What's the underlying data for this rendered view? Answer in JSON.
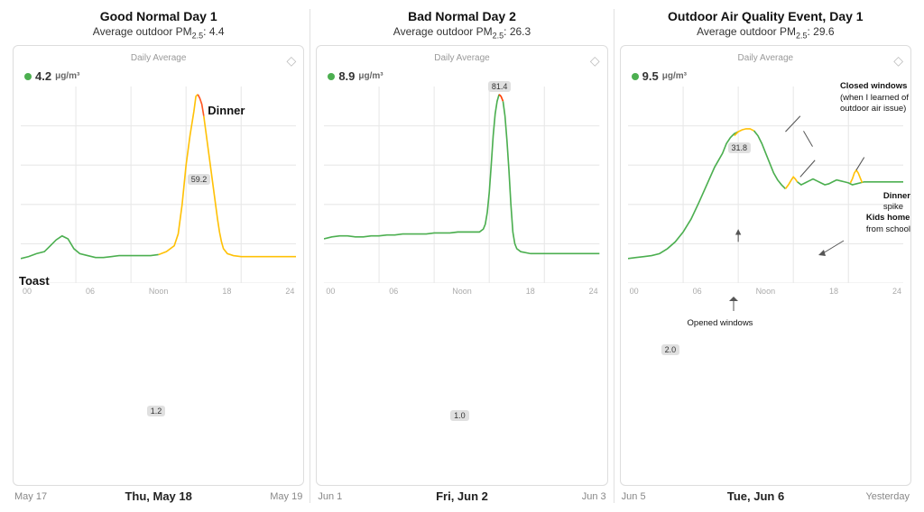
{
  "panels": [
    {
      "id": "panel1",
      "title": "Good Normal Day 1",
      "subtitle": "Average outdoor PM",
      "subtitle_sub": "2.5",
      "subtitle_value": ": 4.4",
      "daily_avg_label": "Daily Average",
      "avg_value": "4.2",
      "avg_unit": "μg/m³",
      "annotations": [
        {
          "label": "Dinner",
          "style": "bold",
          "x_pct": 73,
          "y_pct": 12
        },
        {
          "label": "Toast",
          "style": "bold",
          "x_pct": 5,
          "y_pct": 65
        }
      ],
      "badges": [
        {
          "value": "59.2",
          "x_pct": 68,
          "y_pct": 26
        },
        {
          "value": "1.2",
          "x_pct": 52,
          "y_pct": 85
        }
      ],
      "x_labels": [
        "00",
        "06",
        "Noon",
        "18",
        "24"
      ],
      "dates": {
        "left": "May 17",
        "main": "Thu, May 18",
        "right": "May 19"
      }
    },
    {
      "id": "panel2",
      "title": "Bad Normal Day 2",
      "subtitle": "Average outdoor PM",
      "subtitle_sub": "2.5",
      "subtitle_value": ": 26.3",
      "daily_avg_label": "Daily Average",
      "avg_value": "8.9",
      "avg_unit": "μg/m³",
      "annotations": [],
      "badges": [
        {
          "value": "81.4",
          "x_pct": 68,
          "y_pct": 10
        },
        {
          "value": "1.0",
          "x_pct": 52,
          "y_pct": 87
        }
      ],
      "x_labels": [
        "00",
        "06",
        "Noon",
        "18",
        "24"
      ],
      "dates": {
        "left": "Jun 1",
        "main": "Fri, Jun 2",
        "right": "Jun 3"
      }
    },
    {
      "id": "panel3",
      "title": "Outdoor Air Quality Event, Day 1",
      "subtitle": "Average outdoor PM",
      "subtitle_sub": "2.5",
      "subtitle_value": ": 29.6",
      "daily_avg_label": "Daily Average",
      "avg_value": "9.5",
      "avg_unit": "μg/m³",
      "annotations": [
        {
          "label": "Closed windows",
          "sublabel": "(when I learned of",
          "sublabel2": "outdoor air issue)",
          "x_pct": 73,
          "y_pct": 12
        },
        {
          "label": "Kids home",
          "sublabel": "from school",
          "x_pct": 73,
          "y_pct": 42
        },
        {
          "label": "Dinner",
          "sublabel": "spike",
          "x_pct": 87,
          "y_pct": 38
        },
        {
          "label": "Opened windows",
          "x_pct": 45,
          "y_pct": 73
        }
      ],
      "badges": [
        {
          "value": "31.8",
          "x_pct": 45,
          "y_pct": 24
        },
        {
          "value": "2.0",
          "x_pct": 20,
          "y_pct": 72
        }
      ],
      "x_labels": [
        "00",
        "06",
        "Noon",
        "18",
        "24"
      ],
      "dates": {
        "left": "Jun 5",
        "main": "Tue, Jun 6",
        "right": "Yesterday"
      }
    }
  ]
}
